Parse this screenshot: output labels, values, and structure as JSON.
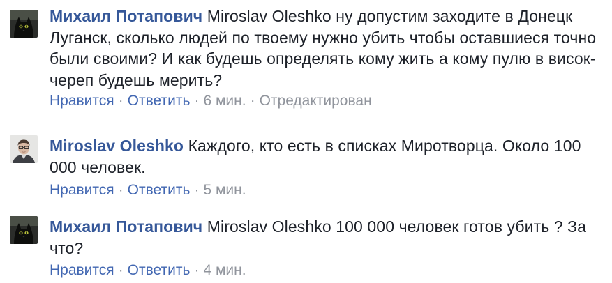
{
  "comments": [
    {
      "author": "Михаил Потапович",
      "text": "Miroslav Oleshko ну допустим заходите в Донецк Луганск, сколько людей по твоему нужно убить чтобы оставшиеся точно были своими? И как будешь определять кому жить а кому пулю в висок-череп будешь мерить?",
      "avatar": "black-cat-avatar",
      "actions": {
        "like": "Нравится",
        "reply": "Ответить",
        "time": "6 мин.",
        "edited": "Отредактирован",
        "separator": "·"
      }
    },
    {
      "author": "Miroslav Oleshko",
      "text": "Каждого, кто есть в списках Миротворца. Около 100 000 человек.",
      "avatar": "man-glasses-avatar",
      "actions": {
        "like": "Нравится",
        "reply": "Ответить",
        "time": "5 мин.",
        "separator": "·"
      }
    },
    {
      "author": "Михаил Потапович",
      "text": "Miroslav Oleshko 100 000 человек готов убить ? За что?",
      "avatar": "black-cat-avatar",
      "actions": {
        "like": "Нравится",
        "reply": "Ответить",
        "time": "4 мин.",
        "separator": "·"
      }
    }
  ],
  "colors": {
    "author": "#365899",
    "link": "#4267b2",
    "meta": "#90949c",
    "text": "#1d2129"
  }
}
